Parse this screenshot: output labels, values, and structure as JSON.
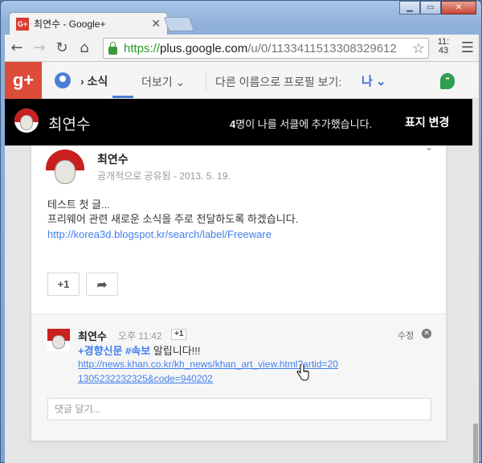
{
  "browser": {
    "tab_title": "최연수 - Google+",
    "tab_favicon": "G+",
    "url_scheme": "https://",
    "url_host": "plus.google.com",
    "url_path": "/u/0/113341151330832961​2",
    "clock_top": "11:",
    "clock_bottom": "43",
    "close_label": "✕",
    "min_label": "▁",
    "max_label": "▭"
  },
  "gplus_nav": {
    "logo": "g+",
    "current_section": "› 소식",
    "more_label": "더보기 ⌄",
    "view_as_label": "다른 이름으로 프로필 보기:",
    "view_as_value": "나 ⌄",
    "hangouts_glyph": "❞"
  },
  "profile": {
    "name": "최연수",
    "circles_count": "4",
    "circles_text": "명이 나를 서클에 추가했습니다.",
    "change_view": "표지 변경"
  },
  "post": {
    "author": "최연수",
    "visibility": "공개적으로 공유됨",
    "date": "- 2013. 5. 19.",
    "text_line1": "테스트 첫 글...",
    "text_line2": "프리웨어 관련 새로운 소식을 주로 전달하도록 하겠습니다.",
    "link": "http://korea3d.blogspot.kr/search/label/Freeware",
    "plusone_label": "+1",
    "share_label": "➦"
  },
  "comment": {
    "author": "최연수",
    "time": "오후 11:42",
    "plusone": "+1",
    "edit_label": "수정",
    "close_glyph": "✕",
    "hashtag1": "+경향신문",
    "hashtag2": "#속보",
    "body_text": " 알립니다!!!",
    "url": "http://news.khan.co.kr/kh_news/khan_art_view.html?artid=201305232232325&code=940202",
    "input_placeholder": "댓글 달기..."
  },
  "colors": {
    "gplus_red": "#dd4b39",
    "link_blue": "#427fed",
    "profile_bar": "#000000"
  }
}
